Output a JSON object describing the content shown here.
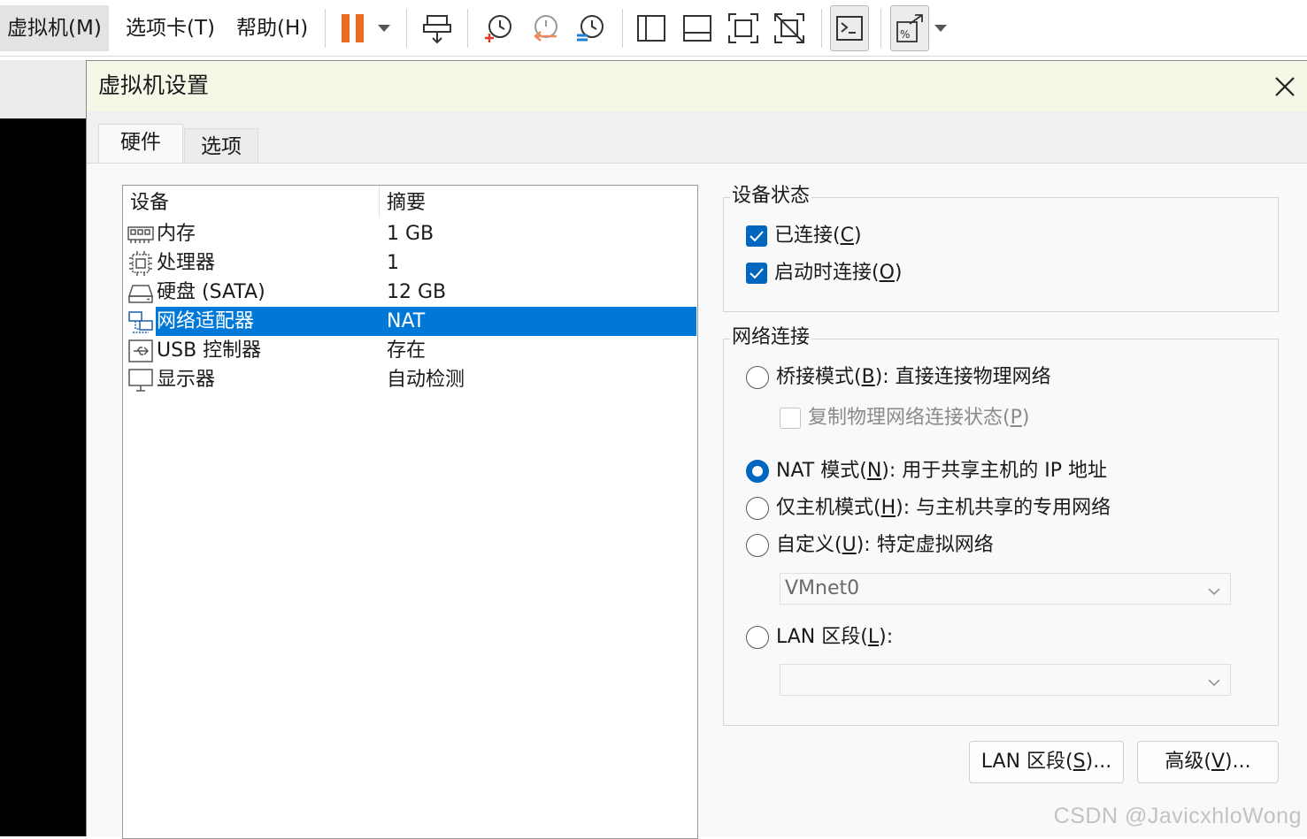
{
  "menu": {
    "vm": "虚拟机(M)",
    "tabs": "选项卡(T)",
    "help": "帮助(H)"
  },
  "toolbar_icons": [
    "pause-icon",
    "dropdown-arrow-icon",
    "send-keys-icon",
    "snapshot-take-icon",
    "snapshot-revert-icon",
    "snapshot-manager-icon",
    "library-view-icon",
    "thumbnail-view-icon",
    "fullscreen-icon",
    "unity-icon",
    "console-icon",
    "stretch-icon"
  ],
  "dialog": {
    "title": "虚拟机设置",
    "tabs": [
      "硬件",
      "选项"
    ]
  },
  "devices": {
    "header": {
      "device": "设备",
      "summary": "摘要"
    },
    "rows": [
      {
        "name": "内存",
        "summary": "1 GB",
        "icon": "memory-icon"
      },
      {
        "name": "处理器",
        "summary": "1",
        "icon": "processor-icon"
      },
      {
        "name": "硬盘 (SATA)",
        "summary": "12 GB",
        "icon": "hard-disk-icon"
      },
      {
        "name": "网络适配器",
        "summary": "NAT",
        "icon": "network-adapter-icon",
        "selected": true
      },
      {
        "name": "USB 控制器",
        "summary": "存在",
        "icon": "usb-icon"
      },
      {
        "name": "显示器",
        "summary": "自动检测",
        "icon": "display-icon"
      }
    ]
  },
  "device_status": {
    "label": "设备状态",
    "connected": {
      "text": "已连接(",
      "key": "C",
      "end": ")",
      "checked": true
    },
    "connect_at_power_on": {
      "text": "启动时连接(",
      "key": "O",
      "end": ")",
      "checked": true
    }
  },
  "network": {
    "label": "网络连接",
    "bridged": {
      "text": "桥接模式(",
      "key": "B",
      "end": "): 直接连接物理网络",
      "selected": false
    },
    "replicate": {
      "text": "复制物理网络连接状态(",
      "key": "P",
      "end": ")",
      "checked": false
    },
    "nat": {
      "text": "NAT 模式(",
      "key": "N",
      "end": "): 用于共享主机的 IP 地址",
      "selected": true
    },
    "host_only": {
      "text": "仅主机模式(",
      "key": "H",
      "end": "): 与主机共享的专用网络",
      "selected": false
    },
    "custom": {
      "text": "自定义(",
      "key": "U",
      "end": "): 特定虚拟网络",
      "selected": false
    },
    "custom_select": "VMnet0",
    "lan_segment": {
      "text": "LAN 区段(",
      "key": "L",
      "end": "):",
      "selected": false
    },
    "lan_select": ""
  },
  "buttons": {
    "lan_segments": {
      "text": "LAN 区段(",
      "key": "S",
      "end": ")..."
    },
    "advanced": {
      "text": "高级(",
      "key": "V",
      "end": ")..."
    }
  },
  "watermark": "CSDN @JavicxhloWong",
  "colors": {
    "accent": "#0067c0",
    "selection": "#0078d7",
    "pause": "#f06b1f",
    "titlebar": "#f4f8e6"
  }
}
